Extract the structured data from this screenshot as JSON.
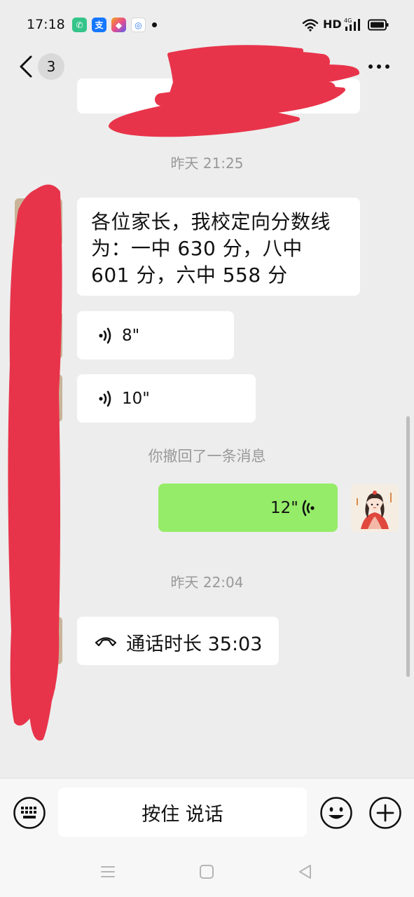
{
  "status_bar": {
    "time": "17:18",
    "network_label": "HD",
    "apps": [
      {
        "name": "phone-app",
        "glyph": "✆",
        "color": "#35c48a"
      },
      {
        "name": "alipay-app",
        "glyph": "支",
        "color": "#1677ff"
      },
      {
        "name": "shortcut-app",
        "glyph": "◆",
        "color": "#e94d8a"
      },
      {
        "name": "browser-app",
        "glyph": "◎",
        "color": "#2f7cf6"
      }
    ]
  },
  "header": {
    "unread_count": "3",
    "title": ""
  },
  "messages": {
    "time_1": "昨天 21:25",
    "text_1": "各位家长，我校定向分数线为：一中 630 分，八中 601 分，六中 558 分",
    "voice_1": "8\"",
    "voice_2": "10\"",
    "recalled": "你撤回了一条消息",
    "voice_sent": "12\"",
    "time_2": "昨天 22:04",
    "call_duration": "通话时长 35:03"
  },
  "input_bar": {
    "hold_to_talk": "按住 说话"
  },
  "colors": {
    "background": "#ededed",
    "sent_bubble": "#95ec69",
    "received_bubble": "#ffffff",
    "redaction": "#e8344a"
  }
}
